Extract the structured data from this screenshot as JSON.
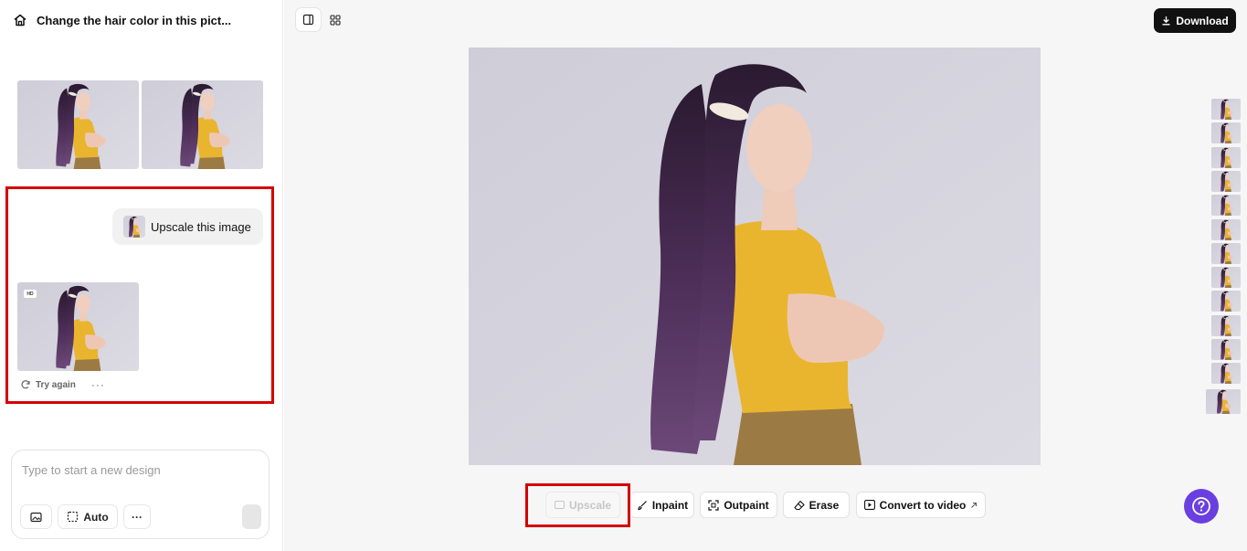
{
  "header": {
    "title": "Change the hair color in this pict..."
  },
  "chat": {
    "prompt_text": "Upscale this image",
    "result_badge": "HD",
    "try_again_label": "Try again",
    "more_label": "···"
  },
  "composer": {
    "placeholder": "Type to start a new design",
    "auto_label": "Auto",
    "more_label": "···"
  },
  "topbar": {
    "download_label": "Download"
  },
  "toolbar": {
    "upscale_label": "Upscale",
    "inpaint_label": "Inpaint",
    "outpaint_label": "Outpaint",
    "erase_label": "Erase",
    "convert_label": "Convert to video"
  },
  "colors": {
    "accent": "#6a3fe0",
    "highlight": "#d40000",
    "background_photo": "#d6d4de",
    "hair": "#3b2440",
    "shirt": "#e9b52f",
    "pants": "#9c7a43"
  },
  "rail_thumbnail_count": 13
}
